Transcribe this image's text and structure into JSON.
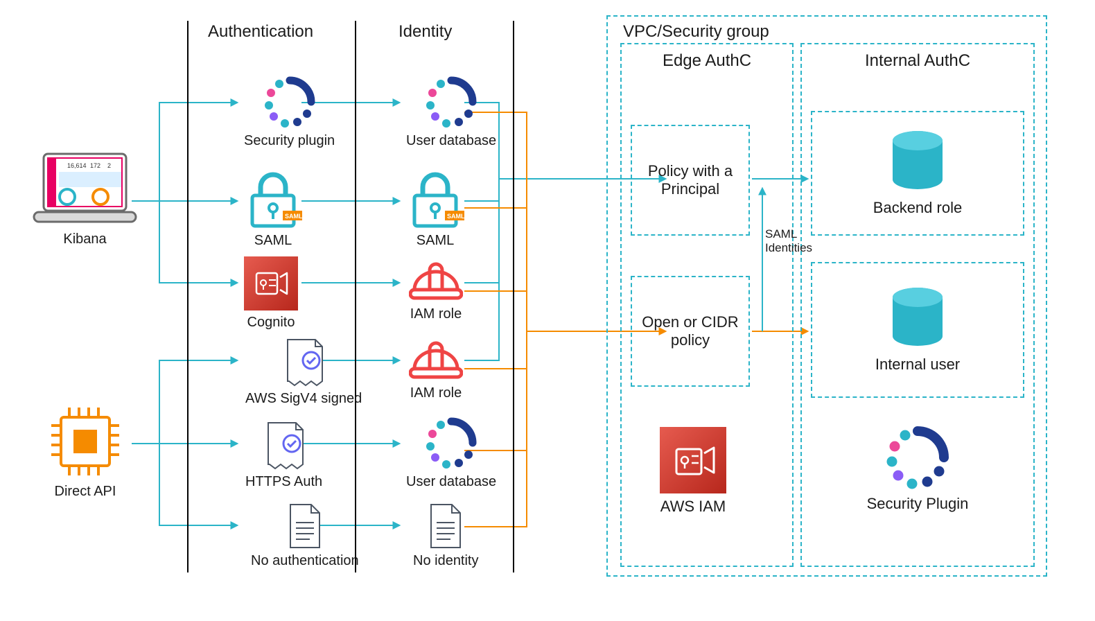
{
  "columns": {
    "auth": "Authentication",
    "identity": "Identity",
    "vpc": "VPC/Security group",
    "edge": "Edge AuthC",
    "internal": "Internal AuthC"
  },
  "sources": {
    "kibana": "Kibana",
    "direct_api": "Direct API"
  },
  "auth": {
    "sec_plugin": "Security plugin",
    "saml": "SAML",
    "cognito": "Cognito",
    "sigv4": "AWS SigV4 signed",
    "https": "HTTPS Auth",
    "none": "No authentication"
  },
  "identity": {
    "userdb1": "User database",
    "saml": "SAML",
    "iam1": "IAM role",
    "iam2": "IAM role",
    "userdb2": "User database",
    "none": "No identity"
  },
  "edge": {
    "policy_principal": "Policy with a Principal",
    "cidr": "Open or CIDR policy",
    "iam": "AWS IAM"
  },
  "internal": {
    "backend_role": "Backend role",
    "internal_user": "Internal user",
    "sec_plugin": "Security Plugin"
  },
  "misc": {
    "saml_identities": "SAML Identities"
  },
  "colors": {
    "teal": "#2bb4c8",
    "orange": "#f58b00",
    "red": "#d13212",
    "darkblue": "#1f3b8f",
    "brand_red": "#d13a2e"
  }
}
